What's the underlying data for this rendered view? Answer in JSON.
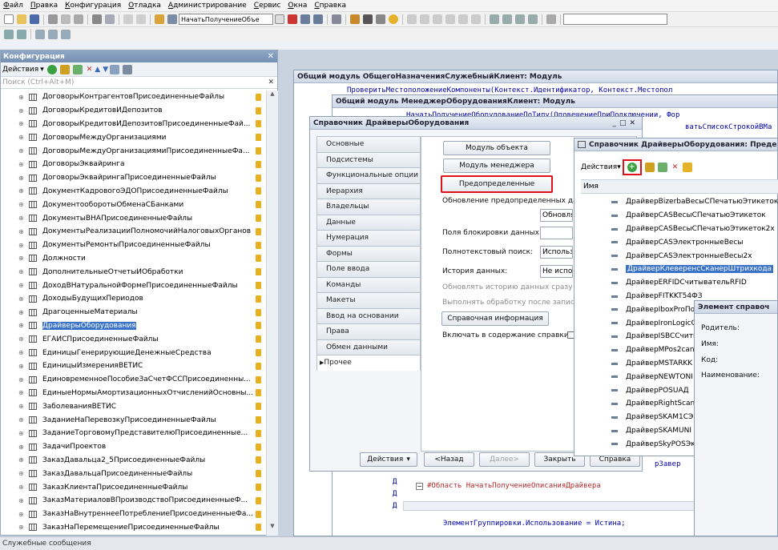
{
  "menu": [
    "Файл",
    "Правка",
    "Конфигурация",
    "Отладка",
    "Администрирование",
    "Сервис",
    "Окна",
    "Справка"
  ],
  "toolbar": {
    "combo_value": "НачатьПолучениеОбъе"
  },
  "config_panel": {
    "title": "Конфигурация",
    "actions_label": "Действия",
    "search_placeholder": "Поиск (Ctrl+Alt+M)",
    "items": [
      "ДоговорыКонтрагентовПрисоединенныеФайлы",
      "ДоговорыКредитовИДепозитов",
      "ДоговорыКредитовИДепозитовПрисоединенныеФай...",
      "ДоговорыМеждуОрганизациями",
      "ДоговорыМеждуОрганизациямиПрисоединенныеФа...",
      "ДоговорыЭквайринга",
      "ДоговорыЭквайрингаПрисоединенныеФайлы",
      "ДокументКадровогоЭДОПрисоединенныеФайлы",
      "ДокументооборотыОбменаСБанками",
      "ДокументыВНАПрисоединенныеФайлы",
      "ДокументыРеализацииПолномочийНалоговыхОрганов",
      "ДокументыРемонтыПрисоединенныеФайлы",
      "Должности",
      "ДополнительныеОтчетыИОбработки",
      "ДоходВНатуральнойФормеПрисоединенныеФайлы",
      "ДоходыБудущихПериодов",
      "ДрагоценныеМатериалы",
      "ДрайверыОборудования",
      "ЕГАИСПрисоединенныеФайлы",
      "ЕдиницыГенерирующиеДенежныеСредства",
      "ЕдиницыИзмеренияВЕТИС",
      "ЕдиновременноеПособиеЗаСчетФССПрисоединенны...",
      "ЕдиныеНормыАмортизационныхОтчисленийОсновны...",
      "ЗаболеванияВЕТИС",
      "ЗаданиеНаПеревозкуПрисоединенныеФайлы",
      "ЗаданиеТорговомуПредставителюПрисоединенные...",
      "ЗадачиПроектов",
      "ЗаказДавальца2_5ПрисоединенныеФайлы",
      "ЗаказДавальцаПрисоединенныеФайлы",
      "ЗаказКлиентаПрисоединенныеФайлы",
      "ЗаказМатериаловВПроизводствоПрисоединенныеФ...",
      "ЗаказНаВнутреннееПотреблениеПрисоединенныеФа...",
      "ЗаказНаПеремещениеПрисоединенныеФайлы"
    ]
  },
  "module1": {
    "title": "Общий модуль ОбщегоНазначенияСлужебныйКлиент: Модуль",
    "line1": "ПроверитьМестоположениеКомпоненты(Контекст.Идентификатор, Контекст.Местопол"
  },
  "module2": {
    "title": "Общий модуль МенеджерОборудованияКлиент: Модуль",
    "line1": "НачатьПолучениеОборудованиеПоТипу(ОповещениеПриПодключении, Фор",
    "line2": "ватьСписокСтрокойВМа",
    "line3": "рЗавер",
    "region": "#Область НачатьПолучениеОписанияДрайвера",
    "code_tail": "ЭлементГруппировки.Использование = Истина;",
    "left_marks": [
      "Д",
      "Д",
      "Д"
    ]
  },
  "props": {
    "title": "Справочник ДрайверыОборудования",
    "tabs": [
      "Основные",
      "Подсистемы",
      "Функциональные опции",
      "Иерархия",
      "Владельцы",
      "Данные",
      "Нумерация",
      "Формы",
      "Поле ввода",
      "Команды",
      "Макеты",
      "Ввод на основании",
      "Права",
      "Обмен данными",
      "Прочее"
    ],
    "btn_object_module": "Модуль объекта",
    "btn_manager_module": "Модуль менеджера",
    "btn_predefined": "Предопределенные",
    "update_predefined_label": "Обновление предопределенных да",
    "update_value": "Обновлят",
    "lock_fields_label": "Поля блокировки данных:",
    "fulltext_label": "Полнотекстовый поиск:",
    "fulltext_value": "Использо",
    "history_label": "История данных:",
    "history_value": "Не испол",
    "update_history_text": "Обновлять историю данных сразу по",
    "run_processing_text": "Выполнять обработку после записи",
    "btn_help": "Справочная информация",
    "include_help": "Включать в содержание справки",
    "footer": {
      "actions": "Действия",
      "back": "<Назад",
      "next": "Далее>",
      "close": "Закрыть",
      "help": "Справка"
    }
  },
  "list": {
    "title": "Справочник ДрайверыОборудования: Преде",
    "actions_label": "Действия",
    "column_name": "Имя",
    "items": [
      "ДрайверBizerbaВесыСПечатьюЭтикеток",
      "ДрайверCASВесыСПечатьюЭтикеток",
      "ДрайверCASВесыСПечатьюЭтикеток2х",
      "ДрайверCASЭлектронныеВесы",
      "ДрайверCASЭлектронныеВесы2х",
      "ДрайверКлеверенсСканерШтрихкода",
      "ДрайверERFIDСчитывательRFID",
      "ДрайверFITKKT54ФЗ",
      "ДрайверIboxProПо",
      "ДрайверIronLogicC",
      "ДрайверISBCСчить",
      "ДрайверMPos2can",
      "ДрайверMSTARKK",
      "ДрайверNEWTONI",
      "ДрайверPOSUAД",
      "ДрайверRightScan",
      "ДрайверSKAM1СЭ",
      "ДрайверSKAMUNI",
      "ДрайверSkyPOSЭк"
    ],
    "selected_index": 5
  },
  "element": {
    "title": "Элемент справоч",
    "fields": [
      "Родитель:",
      "Имя:",
      "Код:",
      "Наименование:"
    ]
  },
  "statusbar": {
    "text": "Служебные сообщения"
  }
}
